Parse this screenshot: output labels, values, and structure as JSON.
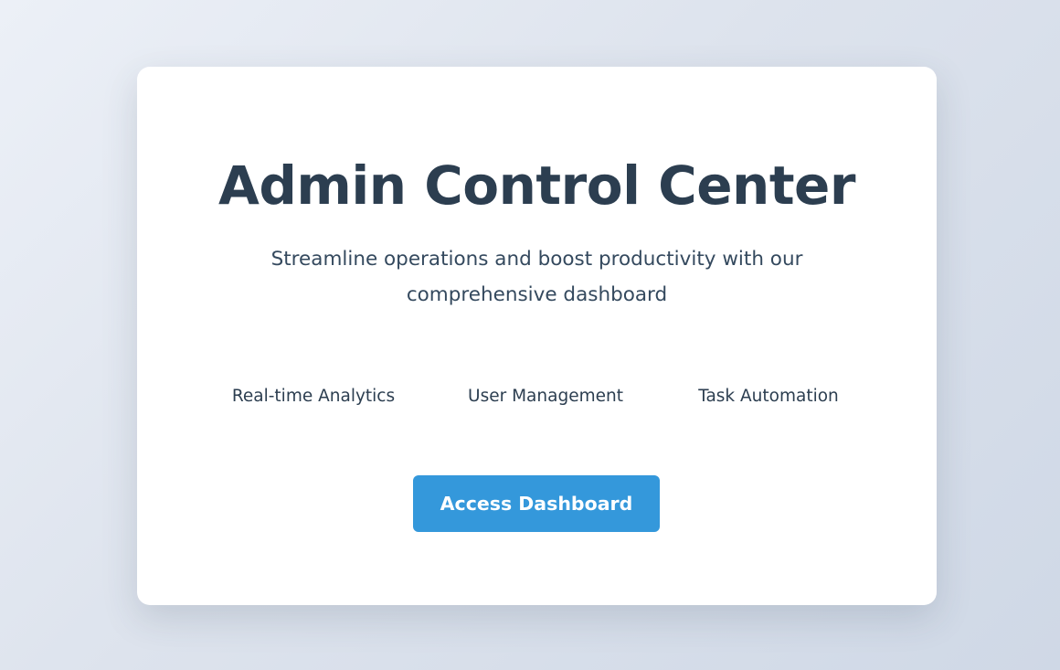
{
  "hero": {
    "title": "Admin Control Center",
    "subtitle": "Streamline operations and boost productivity with our comprehensive dashboard"
  },
  "features": [
    "Real-time Analytics",
    "User Management",
    "Task Automation"
  ],
  "cta": {
    "label": "Access Dashboard"
  },
  "colors": {
    "accent": "#3498db",
    "heading": "#2c3e50",
    "text": "#34495e",
    "card_background": "#ffffff"
  }
}
